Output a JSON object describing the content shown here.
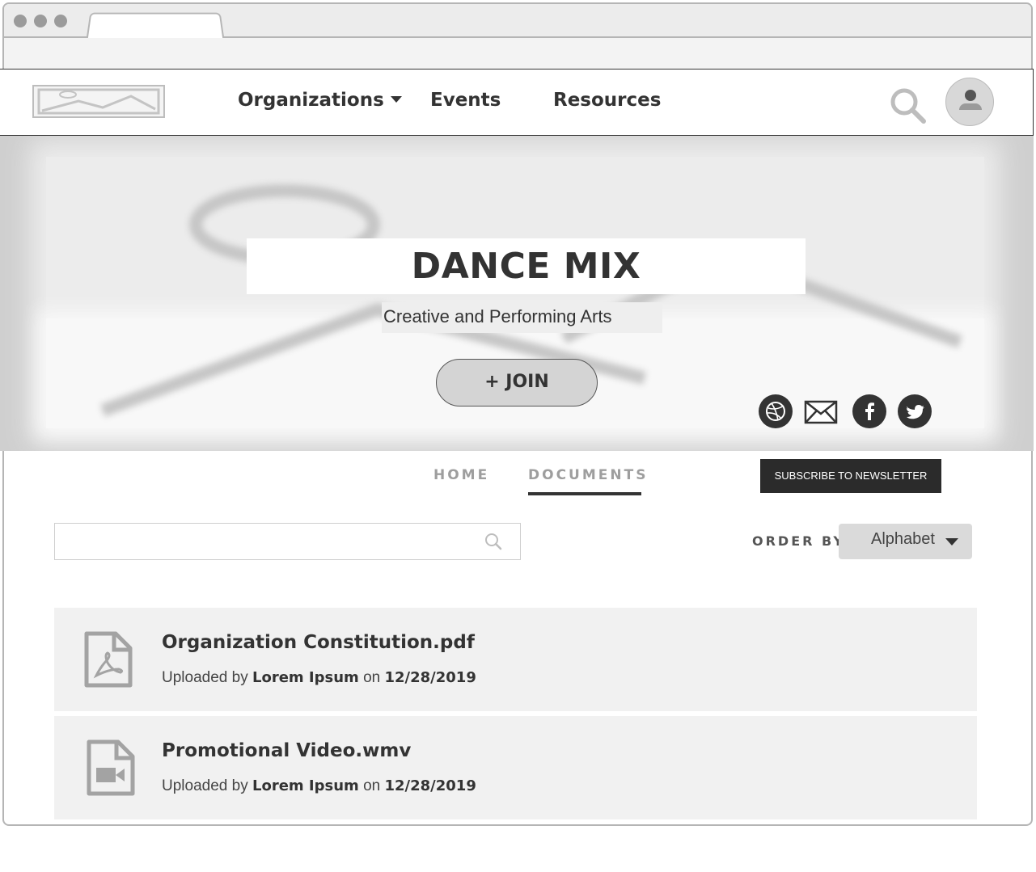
{
  "header": {
    "nav": [
      {
        "label": "Organizations"
      },
      {
        "label": "Events"
      },
      {
        "label": "Resources"
      }
    ]
  },
  "hero": {
    "title": "DANCE MIX",
    "subtitle": "Creative and Performing Arts",
    "join_label": "+ JOIN"
  },
  "tabs": [
    {
      "label": "HOME"
    },
    {
      "label": "DOCUMENTS"
    }
  ],
  "subscribe_label": "SUBSCRIBE TO NEWSLETTER",
  "search": {
    "placeholder": "",
    "value": ""
  },
  "order": {
    "label": "ORDER BY",
    "value": "Alphabet"
  },
  "documents": [
    {
      "name": "Organization Constitution.pdf",
      "uploaded_prefix": "Uploaded by",
      "uploader": "Lorem Ipsum",
      "on": "on",
      "date": "12/28/2019",
      "icon": "pdf-file-icon"
    },
    {
      "name": "Promotional Video.wmv",
      "uploaded_prefix": "Uploaded by",
      "uploader": "Lorem Ipsum",
      "on": "on",
      "date": "12/28/2019",
      "icon": "video-file-icon"
    }
  ],
  "colors": {
    "dark": "#2b2b2b",
    "muted": "#9e9e9e",
    "panel": "#f1f1f1"
  }
}
